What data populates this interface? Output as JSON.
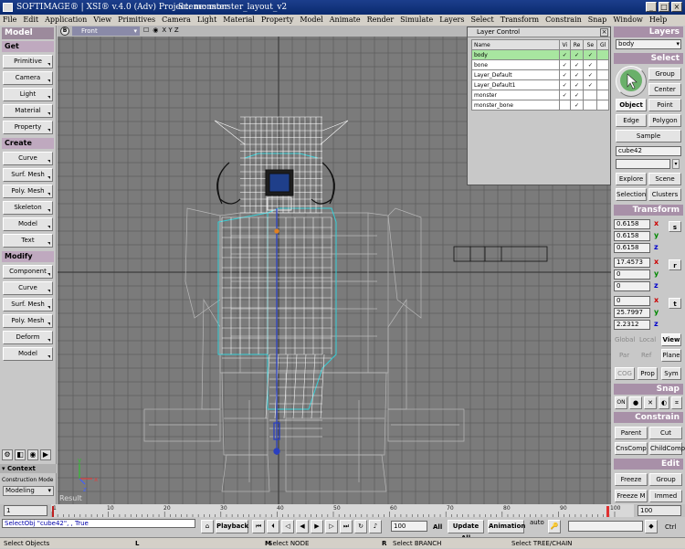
{
  "window": {
    "title": "SOFTIMAGE® | XSI® v.4.0 (Adv) Project: monster",
    "scene": "Scene: monster_layout_v2",
    "buttons": [
      "_",
      "□",
      "×"
    ]
  },
  "menu": [
    "File",
    "Edit",
    "Application",
    "View",
    "Primitives",
    "Camera",
    "Light",
    "Material",
    "Property",
    "Model",
    "Animate",
    "Render",
    "Simulate",
    "Layers",
    "Select",
    "Transform",
    "Constrain",
    "Snap",
    "Window",
    "Help"
  ],
  "left_panel": {
    "header": "Model",
    "get": {
      "label": "Get",
      "items": [
        "Primitive",
        "Camera",
        "Light",
        "Material",
        "Property"
      ]
    },
    "create": {
      "label": "Create",
      "items": [
        "Curve",
        "Surf. Mesh",
        "Poly. Mesh",
        "Skeleton",
        "Model",
        "Text"
      ]
    },
    "modify": {
      "label": "Modify",
      "items": [
        "Component",
        "Curve",
        "Surf. Mesh",
        "Poly. Mesh",
        "Deform",
        "Model"
      ]
    },
    "context": {
      "header": "Context",
      "label": "Construction Mode",
      "mode": "Modeling"
    }
  },
  "viewport": {
    "badge": "B",
    "name": "Front",
    "axes": "X Y Z",
    "result_label": "Result",
    "axis_labels": {
      "x": "x",
      "y": "y",
      "z": "z"
    }
  },
  "layer_control": {
    "title": "Layer Control",
    "columns": [
      "Name",
      "Vi",
      "Re",
      "Se",
      "Gl"
    ],
    "rows": [
      {
        "name": "body",
        "vi": "✓",
        "re": "✓",
        "se": "✓",
        "gl": ""
      },
      {
        "name": "bone",
        "vi": "✓",
        "re": "✓",
        "se": "✓",
        "gl": ""
      },
      {
        "name": "Layer_Default",
        "vi": "✓",
        "re": "✓",
        "se": "✓",
        "gl": ""
      },
      {
        "name": "Layer_Default1",
        "vi": "✓",
        "re": "✓",
        "se": "✓",
        "gl": ""
      },
      {
        "name": "monster",
        "vi": "✓",
        "re": "✓",
        "se": "",
        "gl": ""
      },
      {
        "name": "monster_bone",
        "vi": "",
        "re": "✓",
        "se": "",
        "gl": ""
      }
    ]
  },
  "right_panel": {
    "layers": {
      "header": "Layers",
      "current": "body"
    },
    "select": {
      "header": "Select",
      "group": "Group",
      "center": "Center",
      "object": "Object",
      "point": "Point",
      "edge": "Edge",
      "polygon": "Polygon",
      "sample": "Sample",
      "selected_name": "cube42",
      "explore": "Explore",
      "scene": "Scene",
      "selection": "Selection",
      "clusters": "Clusters"
    },
    "transform": {
      "header": "Transform",
      "scale": [
        "0.6158",
        "0.6158",
        "0.6158"
      ],
      "rotate": [
        "17.4573",
        "0",
        "0"
      ],
      "translate": [
        "0",
        "25.7997",
        "2.2312"
      ],
      "scale_btn": "s",
      "rotate_btn": "r",
      "translate_btn": "t",
      "axis_x": "x",
      "axis_y": "y",
      "axis_z": "z",
      "global": "Global",
      "local": "Local",
      "view": "View",
      "par": "Par",
      "ref": "Ref",
      "plane": "Plane",
      "cog": "COG",
      "prop": "Prop",
      "sym": "Sym"
    },
    "snap": {
      "header": "Snap",
      "on": "ON"
    },
    "constrain": {
      "header": "Constrain",
      "parent": "Parent",
      "cut": "Cut",
      "cnscomp": "CnsComp",
      "childcomp": "ChildComp"
    },
    "edit": {
      "header": "Edit",
      "freeze": "Freeze",
      "group": "Group",
      "freeze_m": "Freeze M",
      "immed": "Immed"
    }
  },
  "timeline": {
    "start": "1",
    "end": "100",
    "ticks": [
      "1",
      "10",
      "20",
      "30",
      "40",
      "50",
      "60",
      "70",
      "80",
      "90",
      "100"
    ]
  },
  "command_bar": {
    "command": "SelectObj \"cube42\", , True",
    "playback": "Playback",
    "frame": "100",
    "all": "All",
    "update_all": "Update All",
    "animation": "Animation",
    "auto": "auto",
    "ctrl": "Ctrl"
  },
  "status_bar": {
    "l": "L",
    "left": "Select Objects",
    "m": "M",
    "middle": "Select NODE",
    "r": "R",
    "right": "Select BRANCH",
    "extra": "Select TREE/CHAIN"
  }
}
